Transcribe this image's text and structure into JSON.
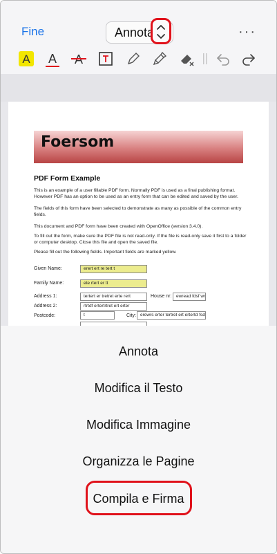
{
  "header": {
    "done_label": "Fine",
    "mode_label": "Annota",
    "more_label": "···"
  },
  "toolbar": {
    "tools": [
      "highlight-text-icon",
      "underline-text-icon",
      "strikethrough-text-icon",
      "text-box-icon",
      "pen-icon",
      "marker-icon",
      "eraser-icon",
      "separator-icon",
      "undo-icon",
      "redo-icon"
    ]
  },
  "document": {
    "banner_title": "Foersom",
    "title": "PDF Form Example",
    "paragraphs": [
      "This is an example of a user fillable PDF form. Normally PDF is used as a final publishing format. However PDF has an option to be used as an entry form that can be edited and saved by the user.",
      "The fields of this form have been selected to demonstrate as many as possible of the common entry fields.",
      "This document and PDF form have been created with OpenOffice (version 3.4.0).",
      "To fill out the form, make sure the PDF file is not read-only. If the file is read-only save it first to a folder or computer desktop. Close this file and open the saved file.",
      "Please fill out the following fields. Important fields are marked yellow."
    ],
    "fields": {
      "given_name_label": "Given Name:",
      "given_name_value": "erert ert re tert t",
      "family_name_label": "Family Name:",
      "family_name_value": "ete rtert er tt",
      "address1_label": "Address 1:",
      "address1_value": "tertert er tretret  erte rert",
      "house_nr_label": "House nr:",
      "house_nr_value": "ewread fdsf wr",
      "address2_label": "Address 2:",
      "address2_value": "rtrtdf ertertrtret ert erter",
      "postcode_label": "Postcode:",
      "postcode_value": "t",
      "city_label": "City:",
      "city_value": "erewrs erter tertret ert ertertd fsdf"
    }
  },
  "menu": {
    "items": [
      "Annota",
      "Modifica il Testo",
      "Modifica Immagine",
      "Organizza le Pagine",
      "Compila e Firma"
    ]
  },
  "colors": {
    "accent": "#1a73e8",
    "highlight_ring": "#e0121b",
    "required_field": "#ecec8e"
  }
}
